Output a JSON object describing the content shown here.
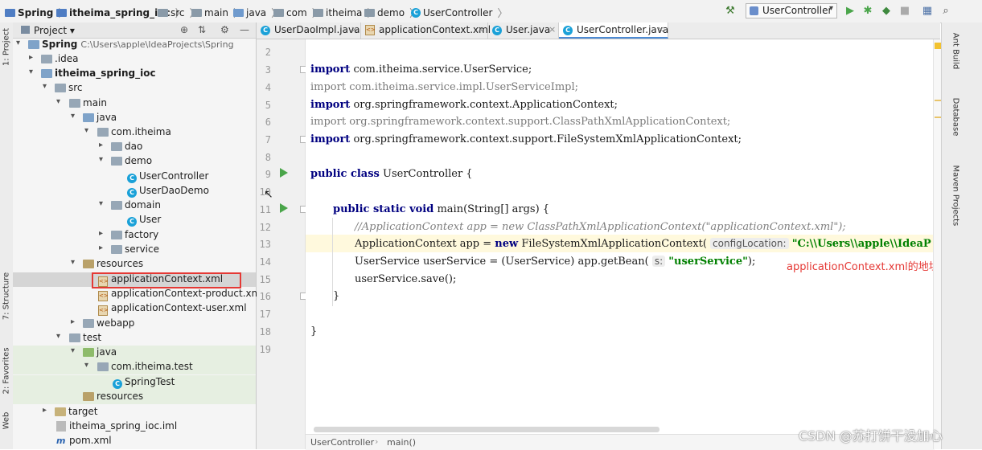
{
  "navbar": {
    "crumbs": [
      "Spring",
      "itheima_spring_ioc",
      "src",
      "main",
      "java",
      "com",
      "itheima",
      "demo",
      "UserController"
    ],
    "run_config": "UserController"
  },
  "left_strip": {
    "tabs": [
      "1: Project",
      "7: Structure",
      "2: Favorites",
      "Web"
    ]
  },
  "project": {
    "header": "Project",
    "tree": [
      {
        "label": "Spring",
        "sub": "C:\\Users\\apple\\IdeaProjects\\Spring",
        "bold": true
      },
      {
        "label": ".idea"
      },
      {
        "label": "itheima_spring_ioc",
        "bold": true
      },
      {
        "label": "src"
      },
      {
        "label": "main"
      },
      {
        "label": "java"
      },
      {
        "label": "com.itheima"
      },
      {
        "label": "dao"
      },
      {
        "label": "demo"
      },
      {
        "label": "UserController"
      },
      {
        "label": "UserDaoDemo"
      },
      {
        "label": "domain"
      },
      {
        "label": "User"
      },
      {
        "label": "factory"
      },
      {
        "label": "service"
      },
      {
        "label": "resources"
      },
      {
        "label": "applicationContext.xml"
      },
      {
        "label": "applicationContext-product.xml"
      },
      {
        "label": "applicationContext-user.xml"
      },
      {
        "label": "webapp"
      },
      {
        "label": "test"
      },
      {
        "label": "java"
      },
      {
        "label": "com.itheima.test"
      },
      {
        "label": "SpringTest"
      },
      {
        "label": "resources"
      },
      {
        "label": "target"
      },
      {
        "label": "itheima_spring_ioc.iml"
      },
      {
        "label": "pom.xml"
      }
    ]
  },
  "tabs": [
    {
      "label": "UserDaoImpl.java"
    },
    {
      "label": "applicationContext.xml"
    },
    {
      "label": "User.java"
    },
    {
      "label": "UserController.java"
    }
  ],
  "editor": {
    "line_numbers": [
      "2",
      "3",
      "4",
      "5",
      "6",
      "7",
      "8",
      "9",
      "10",
      "11",
      "12",
      "13",
      "14",
      "15",
      "16",
      "17",
      "18",
      "19"
    ],
    "code": {
      "l3_kw": "import",
      "l3": " com.itheima.service.UserService;",
      "l4_kw": "import",
      "l4": " com.itheima.service.impl.UserServiceImpl;",
      "l5_kw": "import",
      "l5": " org.springframework.context.ApplicationContext;",
      "l6_kw": "import",
      "l6": " org.springframework.context.support.ClassPathXmlApplicationContext;",
      "l7_kw": "import",
      "l7": " org.springframework.context.support.FileSystemXmlApplicationContext;",
      "l9_kw": "public class",
      "l9": " UserController {",
      "l11_kw": "public static void",
      "l11": " main(String[] args) {",
      "l12": "//ApplicationContext app = new ClassPathXmlApplicationContext(\"applicationContext.xml\");",
      "l13_a": "ApplicationContext app = ",
      "l13_kw": "new",
      "l13_b": " FileSystemXmlApplicationContext(",
      "l13_hint": "configLocation:",
      "l13_str": "\"C:\\\\Users\\\\apple\\\\IdeaP",
      "l14_a": "UserService userService = (UserService) app.getBean(",
      "l14_hint": "s:",
      "l14_str": "\"userService\"",
      "l14_b": ");",
      "l15": "userService.save();",
      "l16": "}",
      "l18": "}"
    },
    "annotation": "applicationContext.xml的地址"
  },
  "bottom_breadcrumb": [
    "UserController",
    "main()"
  ],
  "right_strip": {
    "tabs": [
      "Ant Build",
      "Database",
      "Maven Projects"
    ]
  },
  "watermark": "CSDN @苏打饼干没加心",
  "colors": {
    "accent_red": "#e53935",
    "keyword": "#000080",
    "string": "#008000",
    "run_green": "#4aa54a"
  }
}
